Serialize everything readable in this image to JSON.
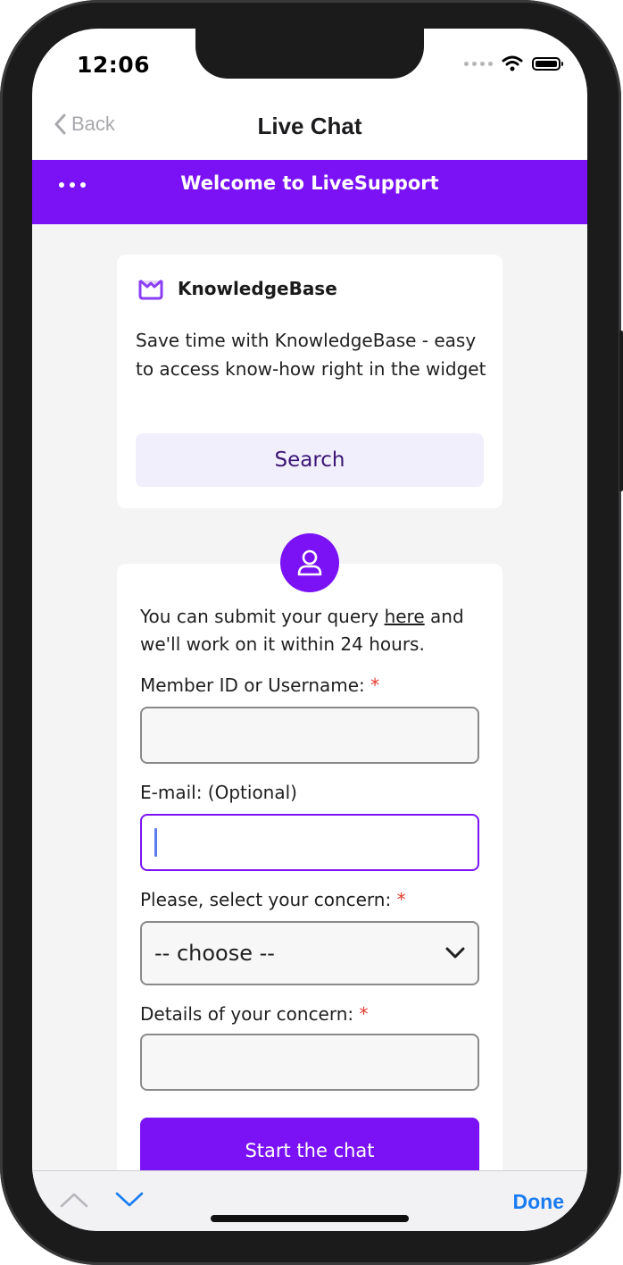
{
  "status_bar": {
    "time": "12:06"
  },
  "nav": {
    "back_label": "Back",
    "title": "Live Chat"
  },
  "banner": {
    "title": "Welcome to LiveSupport"
  },
  "knowledge_base": {
    "title": "KnowledgeBase",
    "description": "Save time with KnowledgeBase - easy to access know-how right in the widget",
    "search_button": "Search"
  },
  "form": {
    "intro_prefix": "You can submit your query ",
    "intro_link": "here",
    "intro_suffix": " and we'll work on it within 24 hours.",
    "member_label": "Member ID or Username:",
    "email_label": "E-mail: (Optional)",
    "concern_label": "Please, select your concern:",
    "concern_selected": "-- choose --",
    "details_label": "Details of your concern:",
    "required_mark": "*",
    "start_button": "Start the chat"
  },
  "toolbar": {
    "done_label": "Done"
  },
  "colors": {
    "accent": "#7a12f5",
    "done_blue": "#1a7cf2",
    "required": "#e53a2f"
  }
}
